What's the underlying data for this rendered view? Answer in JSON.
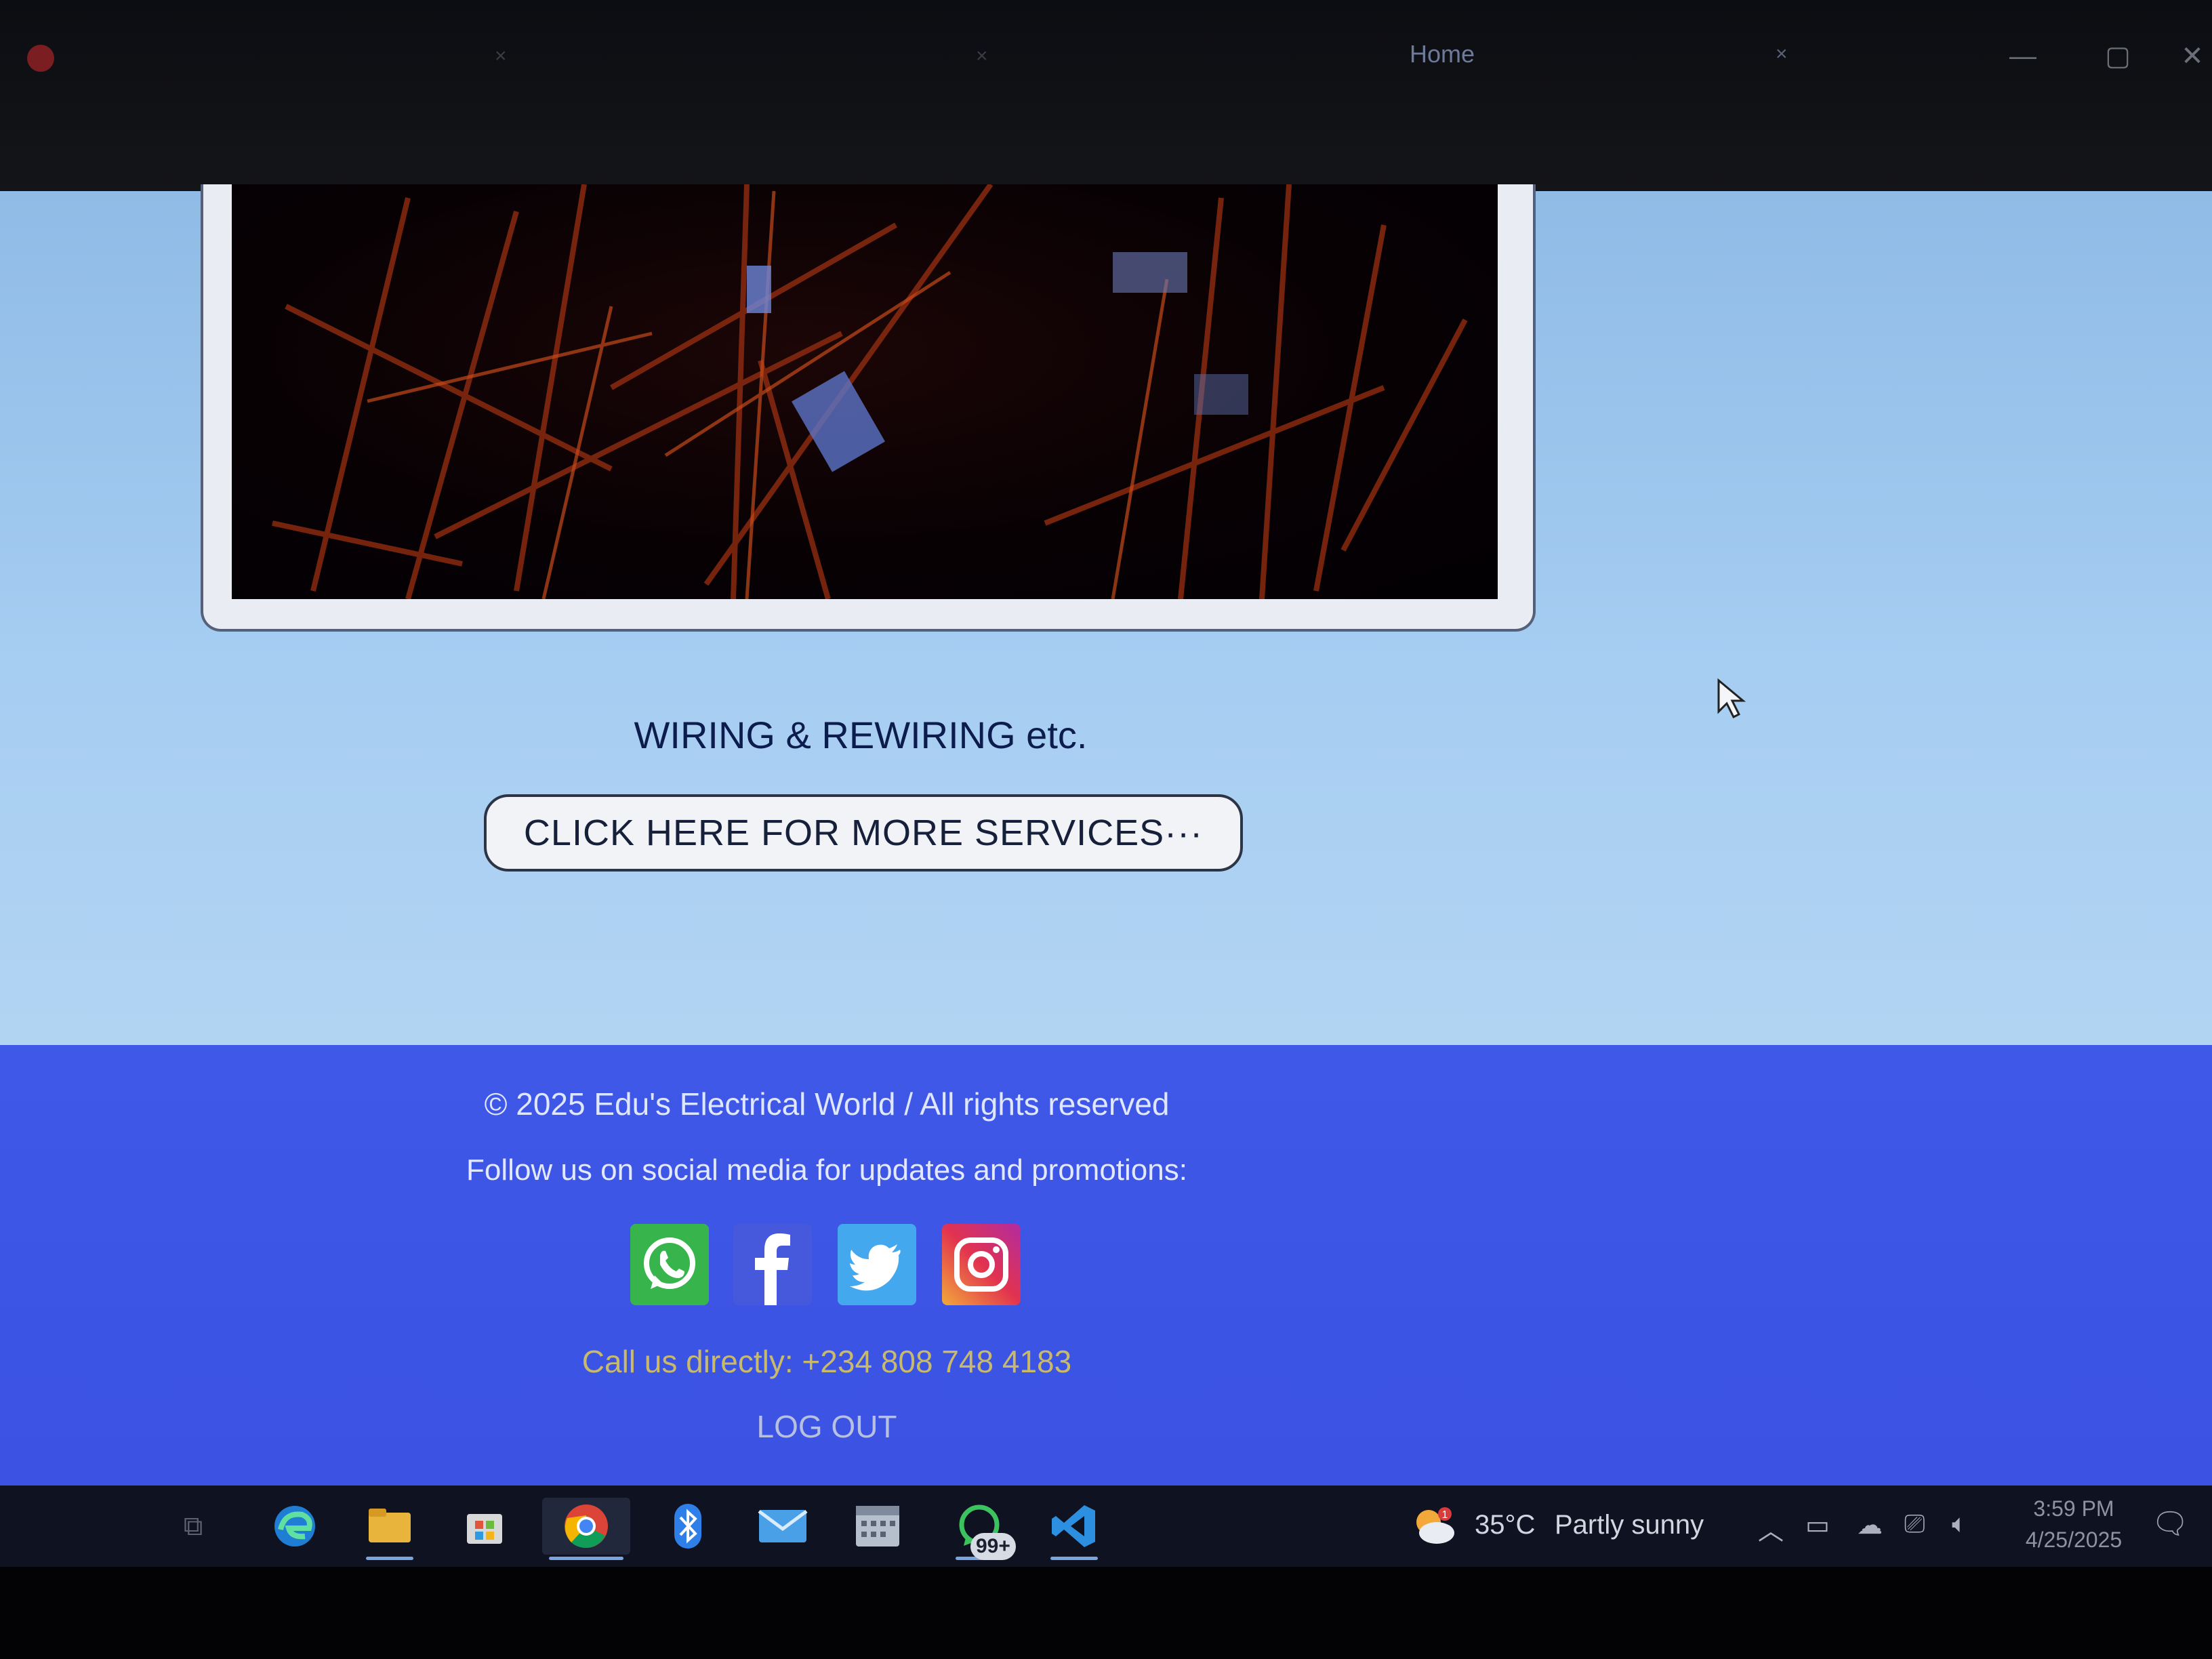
{
  "browser": {
    "tabs": [
      {
        "label": "",
        "active": false
      },
      {
        "label": "",
        "active": false
      },
      {
        "label": "Home",
        "active": true
      }
    ],
    "close_glyph": "×",
    "window_controls": {
      "minimize": "—",
      "maximize": "▢",
      "close": "✕"
    }
  },
  "main": {
    "service_caption": "WIRING & REWIRING etc.",
    "more_services_button": "CLICK HERE FOR MORE SERVICES···"
  },
  "footer": {
    "copyright": "© 2025 Edu's Electrical World / All rights reserved",
    "follow_text": "Follow us on social media for updates and promotions:",
    "social_icons": [
      "whatsapp-icon",
      "facebook-icon",
      "twitter-icon",
      "instagram-icon"
    ],
    "call_line": "Call us directly: +234 808 748 4183",
    "logout": "LOG OUT"
  },
  "taskbar": {
    "apps": [
      "task-view",
      "edge",
      "file-explorer",
      "store",
      "chrome",
      "bluetooth",
      "mail",
      "calendar",
      "whatsapp",
      "vscode"
    ],
    "whatsapp_badge": "99+",
    "weather_alert_count": "1",
    "weather_temp": "35°C",
    "weather_desc": "Partly sunny",
    "clock_time": "3:59 PM",
    "clock_date": "4/25/2025"
  },
  "colors": {
    "page_bg": "#a6cdf2",
    "footer_bg": "#3f58e8",
    "call_text": "#c9b96a",
    "taskbar_bg": "#0f1220"
  }
}
